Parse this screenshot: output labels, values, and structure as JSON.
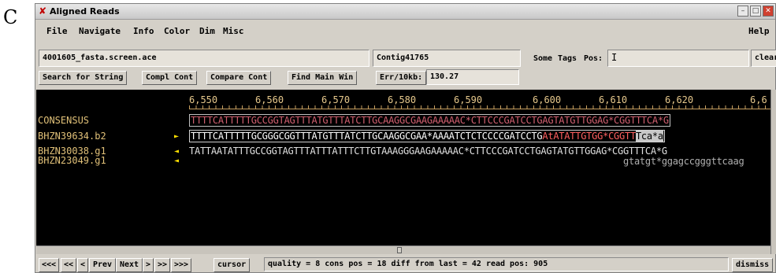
{
  "panel_letter": "C",
  "window": {
    "title": "Aligned Reads"
  },
  "menu": {
    "file": "File",
    "navigate": "Navigate",
    "info": "Info",
    "color": "Color",
    "dim": "Dim",
    "misc": "Misc",
    "help": "Help"
  },
  "toolbar": {
    "filename": "4001605_fasta.screen.ace",
    "contig": "Contig41765",
    "some": "Some",
    "tags": "Tags",
    "pos_label": "Pos:",
    "pos_value": "I",
    "clear": "clear",
    "search": "Search for String",
    "compl_cont": "Compl Cont",
    "compare_cont": "Compare Cont",
    "find_main_win": "Find Main Win",
    "err_label": "Err/10kb:",
    "err_value": "130.27"
  },
  "ruler": {
    "ticks": [
      "6,550",
      "6,560",
      "6,570",
      "6,580",
      "6,590",
      "6,600",
      "6,610",
      "6,620",
      "6,6"
    ]
  },
  "reads": [
    {
      "name": "CONSENSUS",
      "arrow": ""
    },
    {
      "name": "BHZN39634.b2",
      "arrow": "►"
    },
    {
      "name": "BHZN30038.g1",
      "arrow": "◄"
    },
    {
      "name": "BHZN23049.g1",
      "arrow": "◄"
    }
  ],
  "sequences": {
    "consensus": "TTTTCATTTTTGCCGGTAGTTTATGTTTATCTTGCAAGGCGAAGAAAAAC*CTTCCCGATCCTGAGTATGTTGGAG*CGGTTTCA*G",
    "read1_a": "TTTTCATTTTTGCGGGCGGTTTATGTTTATCTTGCAAGGCGAA*AAAATCTCTCCCCGATCCTG",
    "read1_b": "AtATATTGTGG*CGGTT",
    "read1_c": "Tca*a",
    "read2": "TATTAATATTTGCCGGTAGTTTATTTATTTCTTGTAAAGGGAAGAAAAAC*CTTCCCGATCCTGAGTATGTTGGAG*CGGTTTCA*G",
    "read3": "gtatgt*ggagccgggttcaag"
  },
  "nav": {
    "first": "<<<",
    "prev2": "<<",
    "prev1": "<",
    "prev": "Prev",
    "next": "Next",
    "next1": ">",
    "next2": ">>",
    "last": ">>>",
    "cursor": "cursor"
  },
  "status": "quality = 8 cons pos = 18 diff from last = 42 read pos: 905",
  "dismiss": "dismiss",
  "colors": {
    "background": "#000000",
    "read_names": "#e0c078",
    "arrows": "#ffe000",
    "mismatch": "#ff6060"
  }
}
